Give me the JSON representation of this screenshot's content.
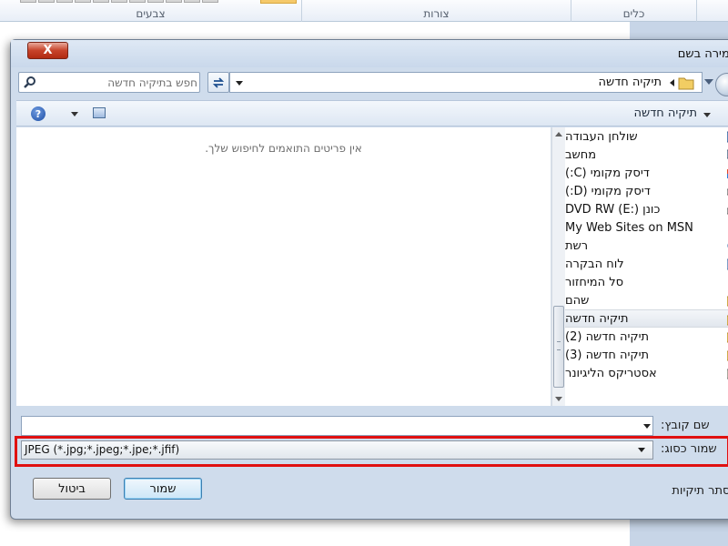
{
  "ribbon": {
    "groups": [
      {
        "label": "צבעים"
      },
      {
        "label": "צורות"
      },
      {
        "label": "כלים"
      }
    ]
  },
  "dialog": {
    "title": "שמירה בשם",
    "close_label": "X",
    "search": {
      "placeholder": "חפש בתיקיה חדשה"
    },
    "address": {
      "path": "תיקיה חדשה"
    },
    "toolbar": {
      "folder_label": "תיקיה חדשה",
      "help_label": "?"
    },
    "content": {
      "empty_message": "אין פריטים התואמים לחיפוש שלך."
    },
    "nav_items": [
      {
        "label": "שולחן העבודה",
        "icon": "desktop-folder-icon"
      },
      {
        "label": "מחשב",
        "icon": "computer-icon"
      },
      {
        "label": "דיסק מקומי (C:)",
        "icon": "windows-drive-icon"
      },
      {
        "label": "דיסק מקומי (D:)",
        "icon": "drive-icon"
      },
      {
        "label": "כונן DVD RW (E:)",
        "icon": "dvd-drive-icon"
      },
      {
        "label": "My Web Sites on MSN",
        "icon": "msn-icon"
      },
      {
        "label": "רשת",
        "icon": "network-icon"
      },
      {
        "label": "לוח הבקרה",
        "icon": "control-panel-icon"
      },
      {
        "label": "סל המיחזור",
        "icon": "recycle-bin-icon"
      },
      {
        "label": "שהם",
        "icon": "folder-icon"
      },
      {
        "label": "תיקיה חדשה",
        "icon": "folder-icon",
        "selected": true
      },
      {
        "label": "תיקיה חדשה (2)",
        "icon": "folder-icon"
      },
      {
        "label": "תיקיה חדשה (3)",
        "icon": "folder-icon"
      },
      {
        "label": "אסטריקס הליגיונר",
        "icon": "archive-folder-icon"
      }
    ],
    "filename": {
      "label": "שם קובץ:",
      "value": ""
    },
    "save_type": {
      "label": "שמור כסוג:",
      "value": "JPEG (*.jpg;*.jpeg;*.jpe;*.jfif)"
    },
    "buttons": {
      "save": "שמור",
      "cancel": "ביטול"
    },
    "hide_folders_label": "הסתר תיקיות"
  },
  "colors": {
    "dialog_bg": "#cfdcec",
    "highlight": "#e01010",
    "close_button": "#c7432a"
  }
}
